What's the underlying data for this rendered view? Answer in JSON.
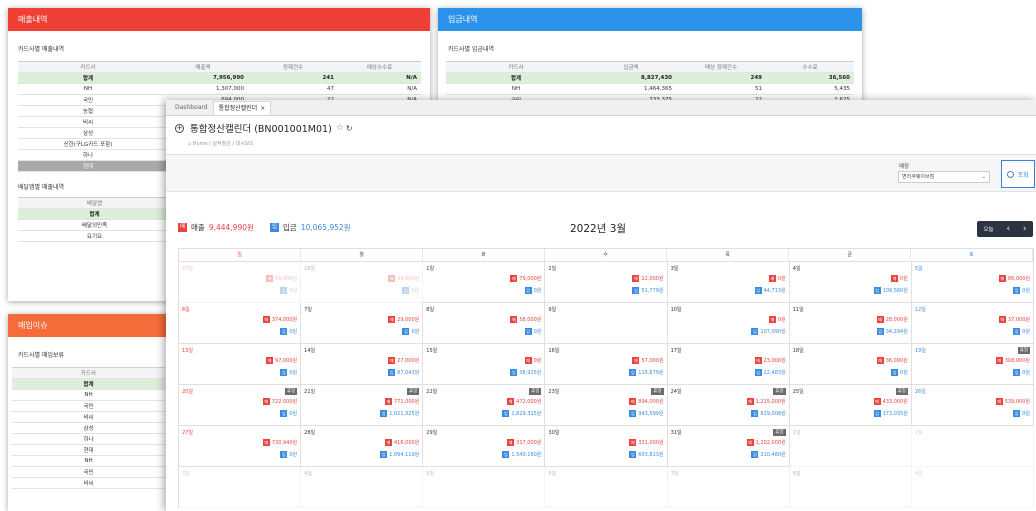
{
  "colors": {
    "sales": "#e94440",
    "deposit": "#3b8be0",
    "sales_header": "#f04035",
    "deposit_header": "#2c93ea",
    "unpaid_header": "#f46c3a"
  },
  "sales_panel": {
    "title": "매출내역",
    "subtitle": "카드사별 매출내역",
    "columns": [
      "카드사",
      "매출액",
      "정제건수",
      "예상수수료"
    ],
    "total": {
      "name": "합계",
      "amount": "7,956,990",
      "count": "241",
      "fee": "N/A"
    },
    "rows": [
      {
        "name": "NH",
        "amount": "1,307,000",
        "count": "47",
        "fee": "N/A"
      },
      {
        "name": "국민",
        "amount": "694,000",
        "count": "22",
        "fee": "N/A"
      },
      {
        "name": "농협",
        "amount": "",
        "count": "",
        "fee": ""
      },
      {
        "name": "비씨",
        "amount": "",
        "count": "",
        "fee": ""
      },
      {
        "name": "삼성",
        "amount": "",
        "count": "",
        "fee": ""
      },
      {
        "name": "신한(구LG카드 포함)",
        "amount": "",
        "count": "",
        "fee": ""
      },
      {
        "name": "하나",
        "amount": "",
        "count": "",
        "fee": ""
      },
      {
        "name": "현대",
        "amount": "",
        "count": "",
        "fee": ""
      }
    ],
    "subtitle2": "배달앱별 매출내역",
    "columns2": [
      "배달앱"
    ],
    "total2": "합계",
    "rows2": [
      "배달의민족",
      "요기요"
    ]
  },
  "deposit_panel": {
    "title": "입금내역",
    "subtitle": "카드사별 입금내역",
    "columns": [
      "카드사",
      "입금액",
      "매상 정제건수",
      "수수료"
    ],
    "total": {
      "name": "합계",
      "amount": "8,827,430",
      "count": "249",
      "fee": "36,560"
    },
    "rows": [
      {
        "name": "NH",
        "amount": "1,464,365",
        "count": "51",
        "fee": "5,435"
      },
      {
        "name": "국민",
        "amount": "733,375",
        "count": "22",
        "fee": "2,625"
      }
    ]
  },
  "unpaid_panel": {
    "title": "매입이슈",
    "subtitle": "카드사별 매입보류",
    "columns": [
      "카드사"
    ],
    "total": "합계",
    "rows": [
      "NH",
      "국민",
      "비씨",
      "삼성",
      "하나",
      "현대",
      "NH",
      "국민",
      "비씨"
    ]
  },
  "main": {
    "tabs": [
      {
        "label": "Dashboard",
        "active": false
      },
      {
        "label": "통합정산캘린더",
        "active": true
      }
    ],
    "tab_close": "×",
    "title": "통합정산캘린더 (BN001001M01)",
    "star": "☆",
    "refresh": "↻",
    "breadcrumb": "⌂ Home / 실적정산 / 대시보드",
    "filter_label": "매장",
    "filter_value": "변리쿠웨이브점",
    "search_label": "조회",
    "sales_label": "매출",
    "sales_total": "9,444,990원",
    "deposit_label": "입금",
    "deposit_total": "10,065,952원",
    "sales_badge": "매",
    "deposit_badge": "입",
    "month_title": "2022년 3월",
    "today_label": "오늘",
    "prev_label": "‹",
    "next_label": "›",
    "weekdays": [
      "일",
      "월",
      "화",
      "수",
      "목",
      "금",
      "토"
    ]
  },
  "calendar": {
    "holiday_label": "휴일",
    "days": [
      {
        "day": "27일",
        "sales": "56,000원",
        "deposit": "0원",
        "faded": true
      },
      {
        "day": "28일",
        "sales": "39,000원",
        "deposit": "0원",
        "faded": true
      },
      {
        "day": "1일",
        "sales": "79,000원",
        "deposit": "0원"
      },
      {
        "day": "2일",
        "sales": "22,000원",
        "deposit": "51,779원"
      },
      {
        "day": "3일",
        "sales": "0원",
        "deposit": "44,713원"
      },
      {
        "day": "4일",
        "sales": "0원",
        "deposit": "109,560원"
      },
      {
        "day": "5일",
        "sales": "86,000원",
        "deposit": "0원"
      },
      {
        "day": "6일",
        "sales": "374,000원",
        "deposit": "0원"
      },
      {
        "day": "7일",
        "sales": "29,000원",
        "deposit": "0원"
      },
      {
        "day": "8일",
        "sales": "58,000원",
        "deposit": "0원"
      },
      {
        "day": "9일",
        "sales": "",
        "deposit": ""
      },
      {
        "day": "10일",
        "sales": "0원",
        "deposit": "107,090원"
      },
      {
        "day": "11일",
        "sales": "28,000원",
        "deposit": "34,294원"
      },
      {
        "day": "12일",
        "sales": "37,000원",
        "deposit": "0원"
      },
      {
        "day": "13일",
        "sales": "97,000원",
        "deposit": "0원"
      },
      {
        "day": "14일",
        "sales": "27,000원",
        "deposit": "87,043원"
      },
      {
        "day": "15일",
        "sales": "0원",
        "deposit": "38,915원"
      },
      {
        "day": "16일",
        "sales": "57,000원",
        "deposit": "115,679원"
      },
      {
        "day": "17일",
        "sales": "23,000원",
        "deposit": "22,483원"
      },
      {
        "day": "18일",
        "sales": "36,000원",
        "deposit": "0원"
      },
      {
        "day": "19일",
        "sales": "308,000원",
        "deposit": "0원",
        "holiday": true
      },
      {
        "day": "20일",
        "sales": "722,000원",
        "deposit": "0원",
        "holiday": true
      },
      {
        "day": "21일",
        "sales": "771,000원",
        "deposit": "1,021,325원",
        "holiday": true
      },
      {
        "day": "22일",
        "sales": "472,000원",
        "deposit": "1,829,315원",
        "holiday": true
      },
      {
        "day": "23일",
        "sales": "894,000원",
        "deposit": "943,599원",
        "holiday": true
      },
      {
        "day": "24일",
        "sales": "1,215,000원",
        "deposit": "829,008원",
        "holiday": true
      },
      {
        "day": "25일",
        "sales": "433,000원",
        "deposit": "373,035원",
        "holiday": true
      },
      {
        "day": "26일",
        "sales": "539,000원",
        "deposit": "0원"
      },
      {
        "day": "27일",
        "sales": "730,940원",
        "deposit": "0원"
      },
      {
        "day": "28일",
        "sales": "416,000원",
        "deposit": "1,094,119원"
      },
      {
        "day": "29일",
        "sales": "317,000원",
        "deposit": "1,540,160원"
      },
      {
        "day": "30일",
        "sales": "331,000원",
        "deposit": "603,813원"
      },
      {
        "day": "31일",
        "sales": "1,202,000원",
        "deposit": "310,460원",
        "holiday": true
      },
      {
        "day": "1일",
        "sales": "",
        "deposit": "",
        "faded": true
      },
      {
        "day": "2일",
        "sales": "",
        "deposit": "",
        "faded": true
      },
      {
        "day": "3일",
        "sales": "",
        "deposit": "",
        "faded": true
      },
      {
        "day": "4일",
        "sales": "",
        "deposit": "",
        "faded": true
      },
      {
        "day": "5일",
        "sales": "",
        "deposit": "",
        "faded": true
      },
      {
        "day": "6일",
        "sales": "",
        "deposit": "",
        "faded": true
      },
      {
        "day": "7일",
        "sales": "",
        "deposit": "",
        "faded": true
      },
      {
        "day": "8일",
        "sales": "",
        "deposit": "",
        "faded": true
      },
      {
        "day": "9일",
        "sales": "",
        "deposit": "",
        "faded": true
      }
    ]
  }
}
